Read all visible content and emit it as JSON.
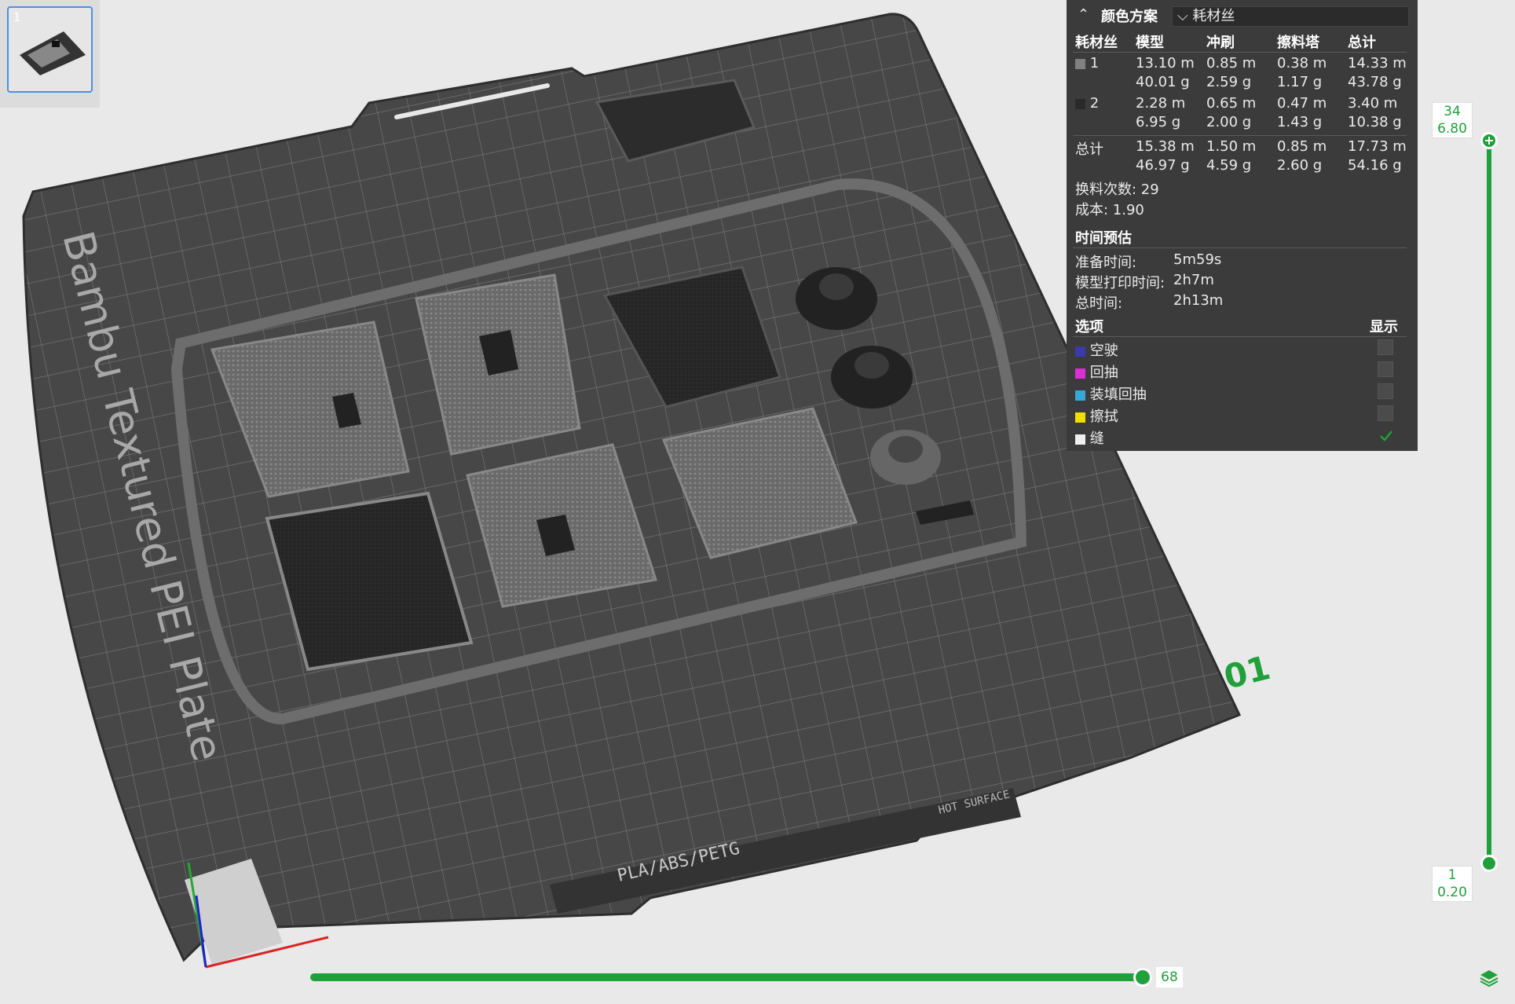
{
  "plate_thumbnail": {
    "number": "1"
  },
  "bed": {
    "label": "Bambu Textured PEI Plate",
    "plate_number": "01",
    "material_label": "PLA/ABS/PETG",
    "hot_surface": "HOT SURFACE"
  },
  "legend": {
    "scheme_label": "颜色方案",
    "scheme_value": "耗材丝",
    "columns": [
      "耗材丝",
      "模型",
      "冲刷",
      "擦料塔",
      "总计"
    ],
    "filaments": [
      {
        "id": "1",
        "color": "#808080",
        "model_m": "13.10 m",
        "model_g": "40.01 g",
        "flush_m": "0.85 m",
        "flush_g": "2.59 g",
        "tower_m": "0.38 m",
        "tower_g": "1.17 g",
        "total_m": "14.33 m",
        "total_g": "43.78 g"
      },
      {
        "id": "2",
        "color": "#2a2a2a",
        "model_m": "2.28 m",
        "model_g": "6.95 g",
        "flush_m": "0.65 m",
        "flush_g": "2.00 g",
        "tower_m": "0.47 m",
        "tower_g": "1.43 g",
        "total_m": "3.40 m",
        "total_g": "10.38 g"
      }
    ],
    "totals": {
      "label": "总计",
      "model_m": "15.38 m",
      "model_g": "46.97 g",
      "flush_m": "1.50 m",
      "flush_g": "4.59 g",
      "tower_m": "0.85 m",
      "tower_g": "2.60 g",
      "total_m": "17.73 m",
      "total_g": "54.16 g"
    },
    "changes": "换料次数: 29",
    "cost": "成本: 1.90",
    "time_header": "时间预估",
    "prep_label": "准备时间:",
    "prep_value": "5m59s",
    "model_time_label": "模型打印时间:",
    "model_time_value": "2h7m",
    "total_time_label": "总时间:",
    "total_time_value": "2h13m",
    "options_label": "选项",
    "display_label": "显示",
    "options": [
      {
        "name": "空驶",
        "color": "#3a3aa8",
        "checked": false
      },
      {
        "name": "回抽",
        "color": "#d82fd8",
        "checked": false
      },
      {
        "name": "装填回抽",
        "color": "#36a7d6",
        "checked": false
      },
      {
        "name": "擦拭",
        "color": "#f0e000",
        "checked": false
      },
      {
        "name": "缝",
        "color": "#efefef",
        "checked": true
      }
    ]
  },
  "layer_slider": {
    "top_layer": "34",
    "top_height": "6.80",
    "bottom_layer": "1",
    "bottom_height": "0.20"
  },
  "move_slider": {
    "value": "68"
  },
  "colors": {
    "accent": "#1fa03a",
    "panel_bg": "#3b3b3b",
    "bed": "#4a4a4a"
  }
}
